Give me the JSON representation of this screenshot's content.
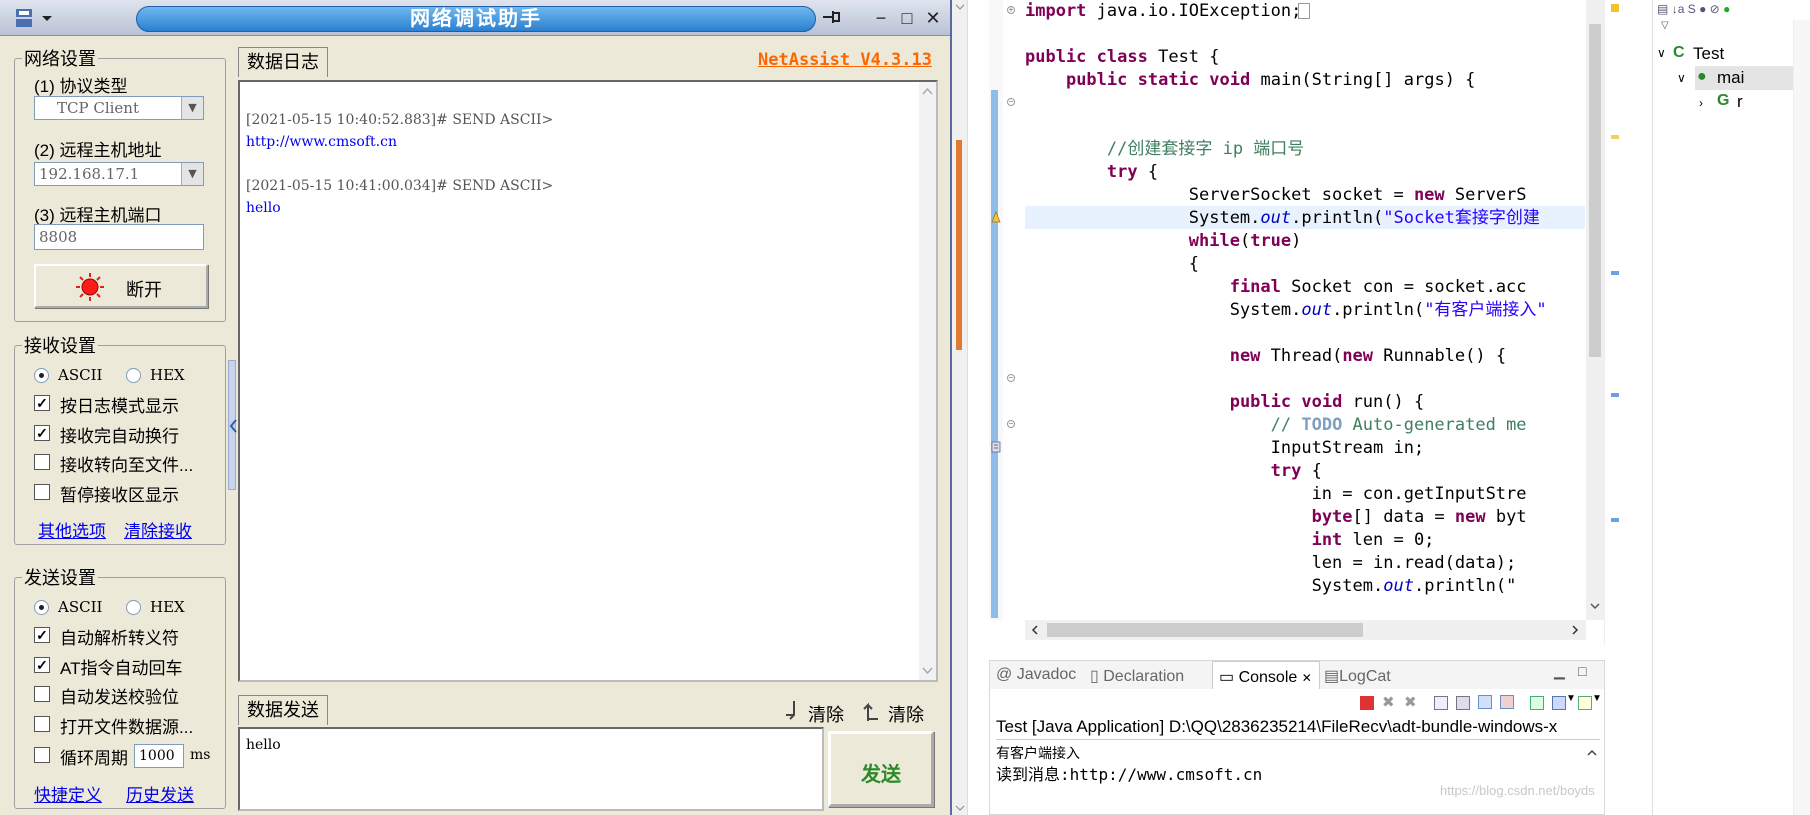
{
  "netassist": {
    "title": "网络调试助手",
    "version": "NetAssist V4.3.13",
    "window_controls": {
      "pin": "pin-icon",
      "minimize": "−",
      "maximize": "□",
      "close": "✕"
    },
    "network": {
      "group": "网络设置",
      "protocol_label": "(1) 协议类型",
      "protocol_value": "TCP Client",
      "host_label": "(2) 远程主机地址",
      "host_value": "192.168.17.1",
      "port_label": "(3) 远程主机端口",
      "port_value": "8808",
      "disconnect_label": "断开"
    },
    "receive": {
      "group": "接收设置",
      "ascii": "ASCII",
      "hex": "HEX",
      "options": [
        {
          "label": "按日志模式显示",
          "checked": true
        },
        {
          "label": "接收完自动换行",
          "checked": true
        },
        {
          "label": "接收转向至文件...",
          "checked": false
        },
        {
          "label": "暂停接收区显示",
          "checked": false
        }
      ],
      "link_more": "其他选项",
      "link_clear": "清除接收"
    },
    "send_settings": {
      "group": "发送设置",
      "ascii": "ASCII",
      "hex": "HEX",
      "options": [
        {
          "label": "自动解析转义符",
          "checked": true
        },
        {
          "label": "AT指令自动回车",
          "checked": true
        },
        {
          "label": "自动发送校验位",
          "checked": false
        },
        {
          "label": "打开文件数据源...",
          "checked": false
        }
      ],
      "cycle_label": "循环周期",
      "cycle_value": "1000",
      "cycle_unit": "ms",
      "link_quick": "快捷定义",
      "link_history": "历史发送"
    },
    "log": {
      "tab": "数据日志",
      "entries": [
        {
          "header": "[2021-05-15 10:40:52.883]# SEND ASCII>",
          "body": "http://www.cmsoft.cn"
        },
        {
          "header": "[2021-05-15 10:41:00.034]# SEND ASCII>",
          "body": "hello"
        }
      ]
    },
    "send": {
      "tab": "数据发送",
      "clear1": "清除",
      "clear2": "清除",
      "text": "hello",
      "button": "发送"
    }
  },
  "eclipse": {
    "code": [
      [
        {
          "t": "import",
          "c": "kw"
        },
        {
          "t": " java.io.IOException;"
        }
      ],
      [],
      [
        {
          "t": "public",
          "c": "kw"
        },
        {
          "t": " "
        },
        {
          "t": "class",
          "c": "kw"
        },
        {
          "t": " Test {"
        }
      ],
      [
        {
          "t": "    "
        },
        {
          "t": "public",
          "c": "kw"
        },
        {
          "t": " "
        },
        {
          "t": "static",
          "c": "kw"
        },
        {
          "t": " "
        },
        {
          "t": "void",
          "c": "kw"
        },
        {
          "t": " main(String[] args) {"
        }
      ],
      [],
      [],
      [
        {
          "t": "        "
        },
        {
          "t": "//创建套接字 ip 端口号",
          "c": "cm"
        }
      ],
      [
        {
          "t": "        "
        },
        {
          "t": "try",
          "c": "kw"
        },
        {
          "t": " {"
        }
      ],
      [
        {
          "t": "                ServerSocket socket = "
        },
        {
          "t": "new",
          "c": "kw"
        },
        {
          "t": " ServerS"
        }
      ],
      [
        {
          "t": "                System."
        },
        {
          "t": "out",
          "c": "fld"
        },
        {
          "t": ".println("
        },
        {
          "t": "\"Socket套接字创建",
          "c": "st"
        }
      ],
      [
        {
          "t": "                "
        },
        {
          "t": "while",
          "c": "kw"
        },
        {
          "t": "("
        },
        {
          "t": "true",
          "c": "kw"
        },
        {
          "t": ")"
        }
      ],
      [
        {
          "t": "                {"
        }
      ],
      [
        {
          "t": "                    "
        },
        {
          "t": "final",
          "c": "kw"
        },
        {
          "t": " Socket con = socket.acc"
        }
      ],
      [
        {
          "t": "                    System."
        },
        {
          "t": "out",
          "c": "fld"
        },
        {
          "t": ".println("
        },
        {
          "t": "\"有客户端接入\"",
          "c": "st"
        }
      ],
      [],
      [
        {
          "t": "                    "
        },
        {
          "t": "new",
          "c": "kw"
        },
        {
          "t": " Thread("
        },
        {
          "t": "new",
          "c": "kw"
        },
        {
          "t": " Runnable() {"
        }
      ],
      [],
      [
        {
          "t": "                    "
        },
        {
          "t": "public",
          "c": "kw"
        },
        {
          "t": " "
        },
        {
          "t": "void",
          "c": "kw"
        },
        {
          "t": " run() {"
        }
      ],
      [
        {
          "t": "                        "
        },
        {
          "t": "// ",
          "c": "cm"
        },
        {
          "t": "TODO",
          "c": "todo"
        },
        {
          "t": " Auto-generated me",
          "c": "cm"
        }
      ],
      [
        {
          "t": "                        InputStream in;"
        }
      ],
      [
        {
          "t": "                        "
        },
        {
          "t": "try",
          "c": "kw"
        },
        {
          "t": " {"
        }
      ],
      [
        {
          "t": "                            in = con.getInputStre"
        }
      ],
      [
        {
          "t": "                            "
        },
        {
          "t": "byte",
          "c": "kw"
        },
        {
          "t": "[] data = "
        },
        {
          "t": "new",
          "c": "kw"
        },
        {
          "t": " byt"
        }
      ],
      [
        {
          "t": "                            "
        },
        {
          "t": "int",
          "c": "kw"
        },
        {
          "t": " len = 0;"
        }
      ],
      [
        {
          "t": "                            len = in.read(data);"
        }
      ],
      [
        {
          "t": "                            System."
        },
        {
          "t": "out",
          "c": "fld"
        },
        {
          "t": ".println(\""
        }
      ]
    ],
    "views": {
      "javadoc": "Javadoc",
      "declaration": "Declaration",
      "console": "Console",
      "logcat": "LogCat"
    },
    "console_header": "Test [Java Application] D:\\QQ\\2836235214\\FileRecv\\adt-bundle-windows-x",
    "console_lines": [
      "有客户端接入",
      "读到消息:http://www.cmsoft.cn"
    ],
    "outline": {
      "root": "Test",
      "child": "mai",
      "grandchild": "r"
    },
    "watermark": "https://blog.csdn.net/boyds"
  }
}
